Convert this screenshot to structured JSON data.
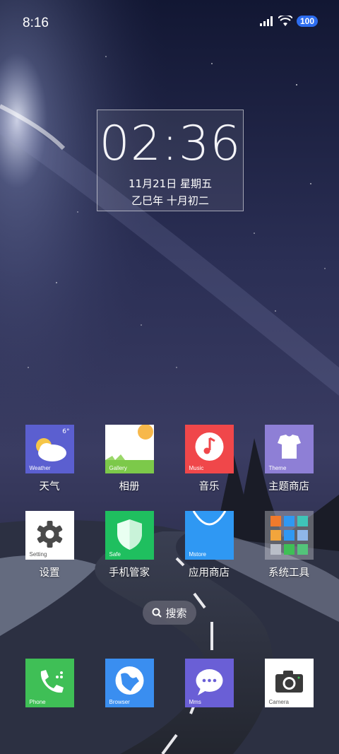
{
  "status_bar": {
    "time": "8:16",
    "battery": "100"
  },
  "clock_widget": {
    "time": "02:36",
    "date": "11月21日 星期五",
    "lunar": "乙巳年 十月初二"
  },
  "apps": [
    {
      "name": "天气",
      "tile_label": "Weather",
      "icon": "weather-icon",
      "color": "#5b5fd0",
      "badge": "6°"
    },
    {
      "name": "相册",
      "tile_label": "Gallery",
      "icon": "gallery-icon",
      "color": "#ffffff"
    },
    {
      "name": "音乐",
      "tile_label": "Music",
      "icon": "music-icon",
      "color": "#f0474a"
    },
    {
      "name": "主题商店",
      "tile_label": "Theme",
      "icon": "theme-icon",
      "color": "#8e7fd6"
    },
    {
      "name": "设置",
      "tile_label": "Setting",
      "icon": "gear-icon",
      "color": "#ffffff"
    },
    {
      "name": "手机管家",
      "tile_label": "Safe",
      "icon": "shield-icon",
      "color": "#1fbf5f"
    },
    {
      "name": "应用商店",
      "tile_label": "Mstore",
      "icon": "store-icon",
      "color": "#2f98f3"
    },
    {
      "name": "系统工具",
      "tile_label": "",
      "icon": "folder-icon",
      "color": "#e8e8ec"
    }
  ],
  "search": {
    "label": "搜索"
  },
  "dock": [
    {
      "tile_label": "Phone",
      "icon": "phone-icon",
      "color": "#3fbf56"
    },
    {
      "tile_label": "Browser",
      "icon": "browser-icon",
      "color": "#3a8ef0"
    },
    {
      "tile_label": "Mms",
      "icon": "message-icon",
      "color": "#6a5fd6"
    },
    {
      "tile_label": "Camera",
      "icon": "camera-icon",
      "color": "#ffffff"
    }
  ]
}
